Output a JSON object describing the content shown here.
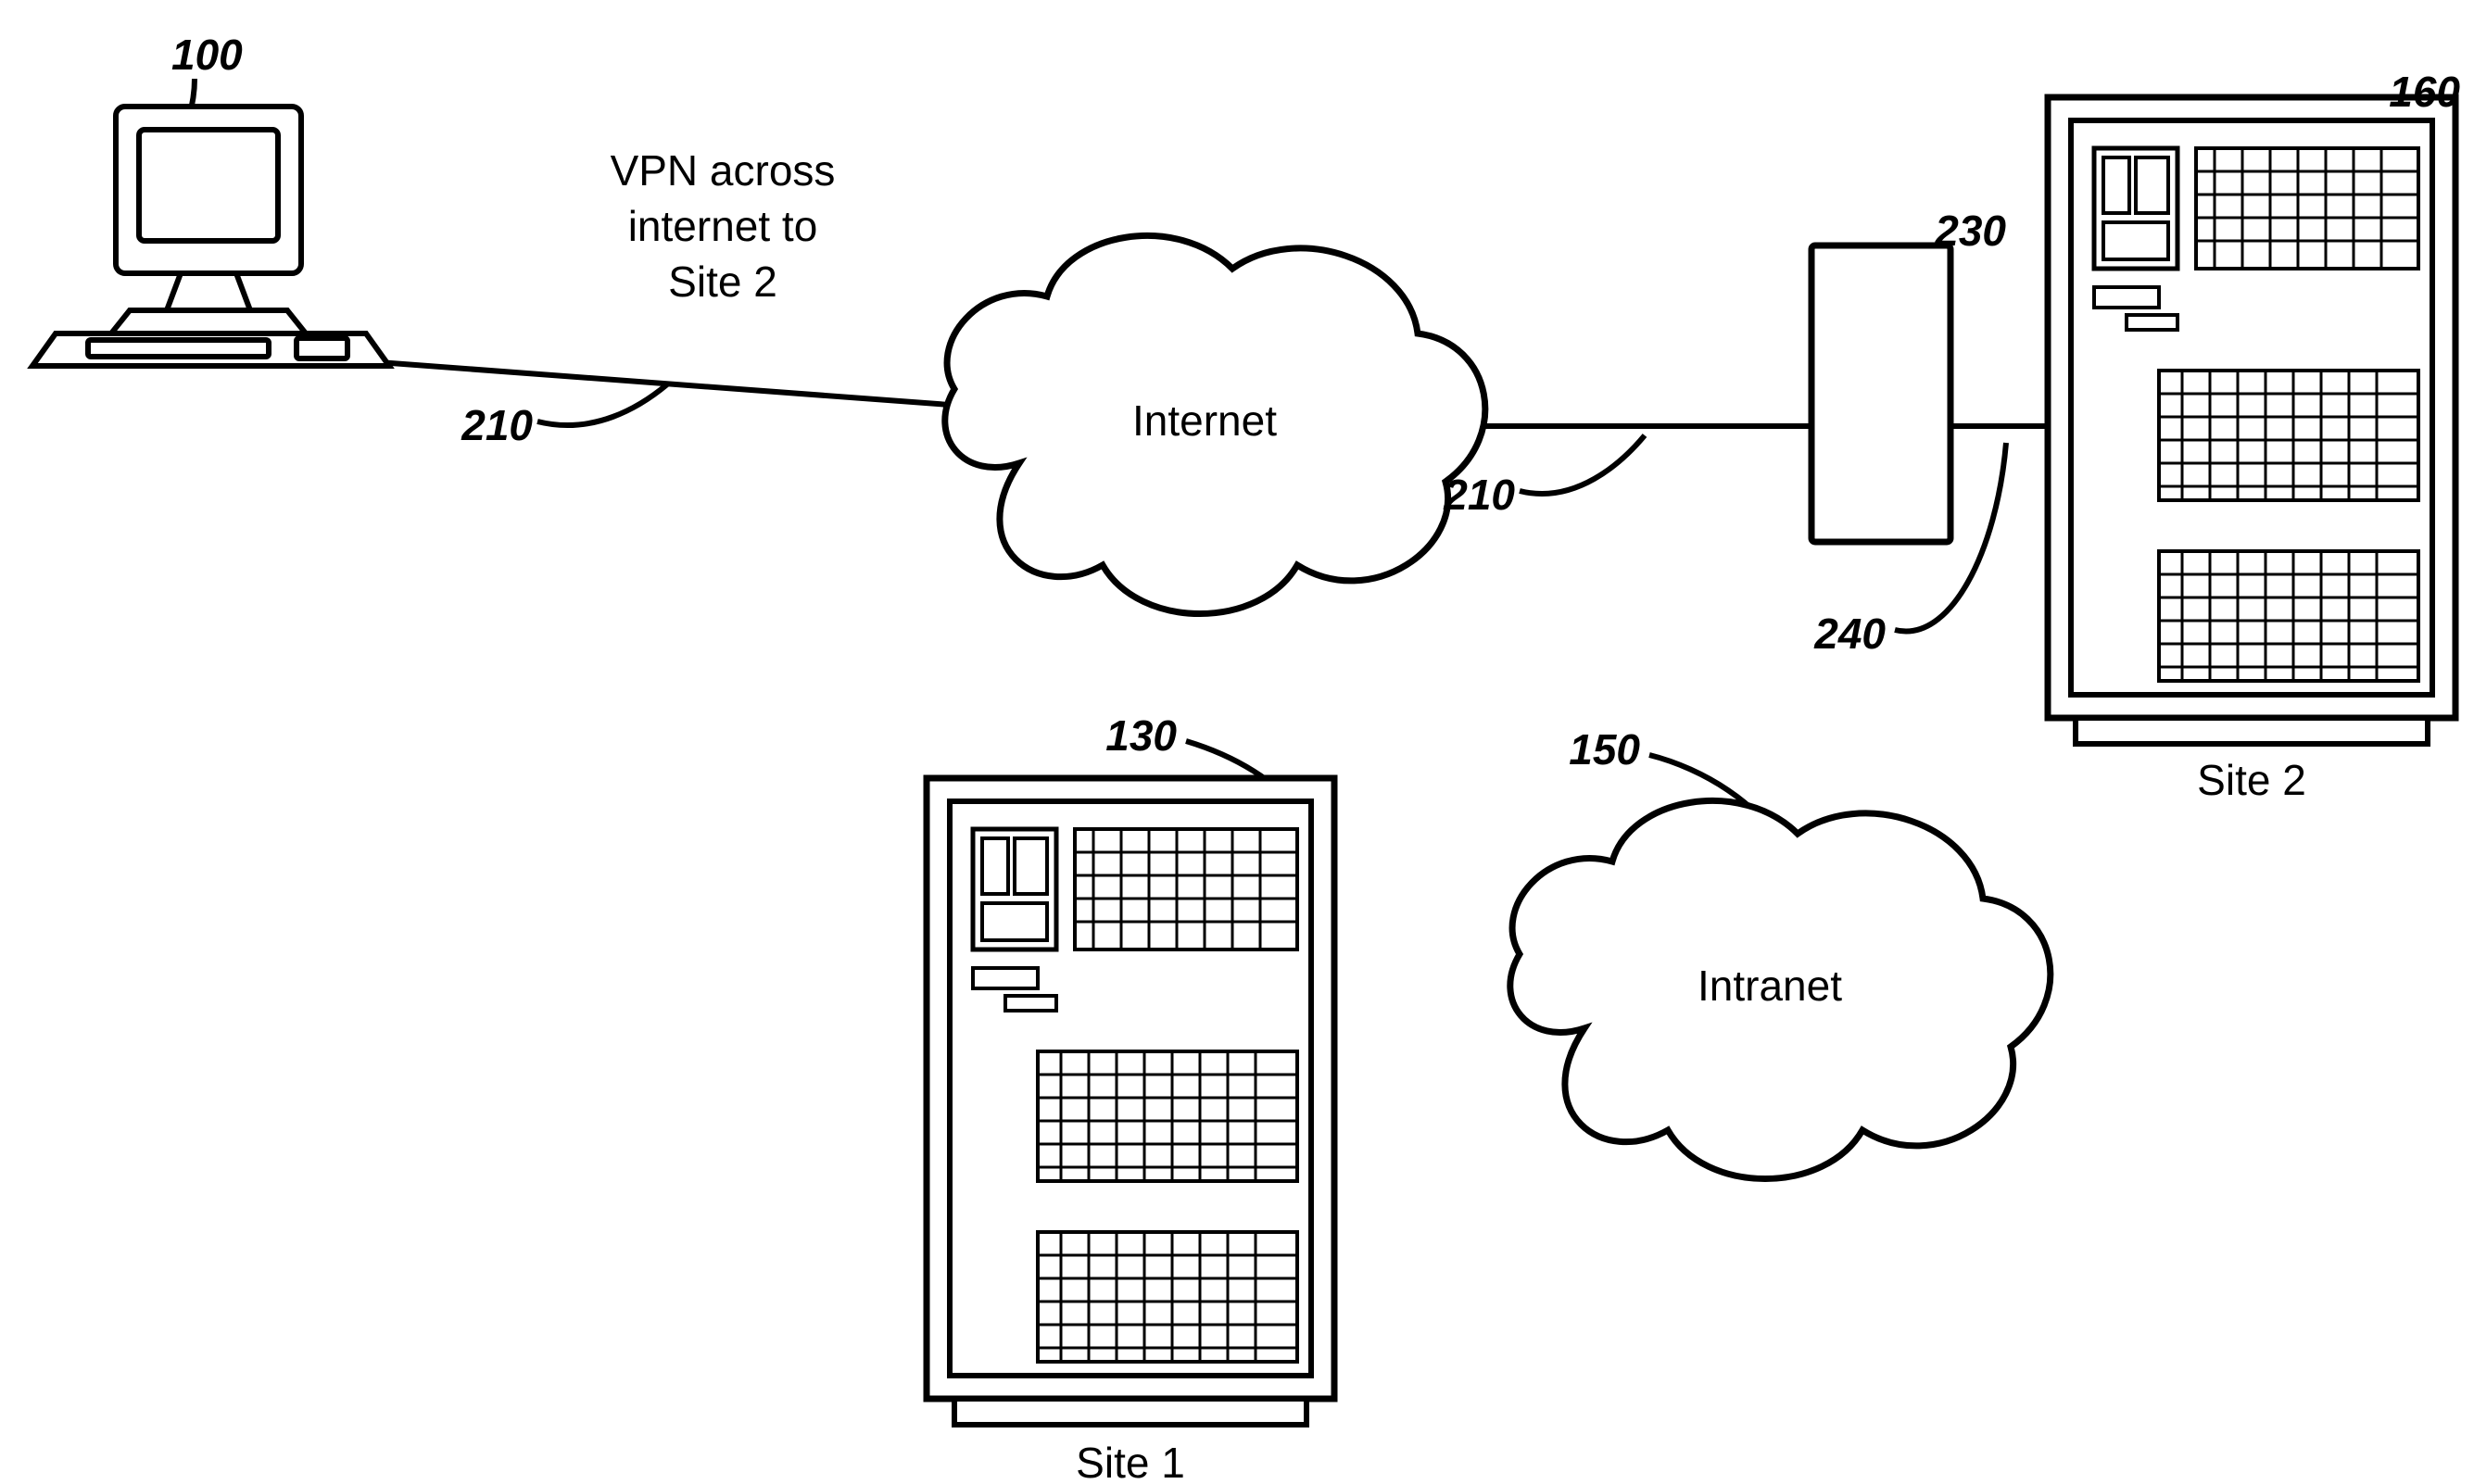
{
  "labels": {
    "vpn_text_1": "VPN across",
    "vpn_text_2": "internet to",
    "vpn_text_3": "Site 2",
    "cloud_internet": "Internet",
    "cloud_intranet": "Intranet",
    "site1": "Site 1",
    "site2": "Site 2"
  },
  "refs": {
    "r100": "100",
    "r210a": "210",
    "r210b": "210",
    "r130": "130",
    "r150": "150",
    "r160": "160",
    "r230": "230",
    "r240": "240"
  }
}
